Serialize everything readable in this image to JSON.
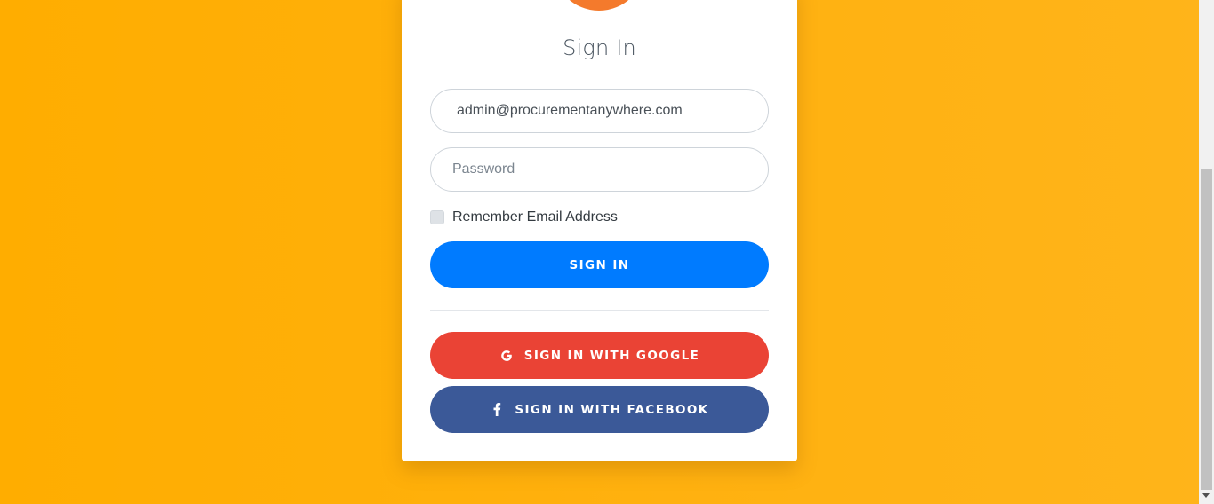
{
  "login": {
    "title": "Sign In",
    "email": {
      "value": "admin@procurementanywhere.com",
      "placeholder": ""
    },
    "password": {
      "value": "",
      "placeholder": "Password"
    },
    "remember_label": "Remember Email Address",
    "remember_checked": false,
    "signin_label": "SIGN IN",
    "google_label": "SIGN IN WITH GOOGLE",
    "facebook_label": "SIGN IN WITH FACEBOOK"
  },
  "icons": {
    "google": "google-icon",
    "facebook": "facebook-icon",
    "scroll_down": "scroll-down-arrow-icon"
  },
  "colors": {
    "background": "#ffad00",
    "logo": "#f47a2c",
    "signin": "#007bff",
    "google": "#ea4335",
    "facebook": "#3b5998"
  }
}
